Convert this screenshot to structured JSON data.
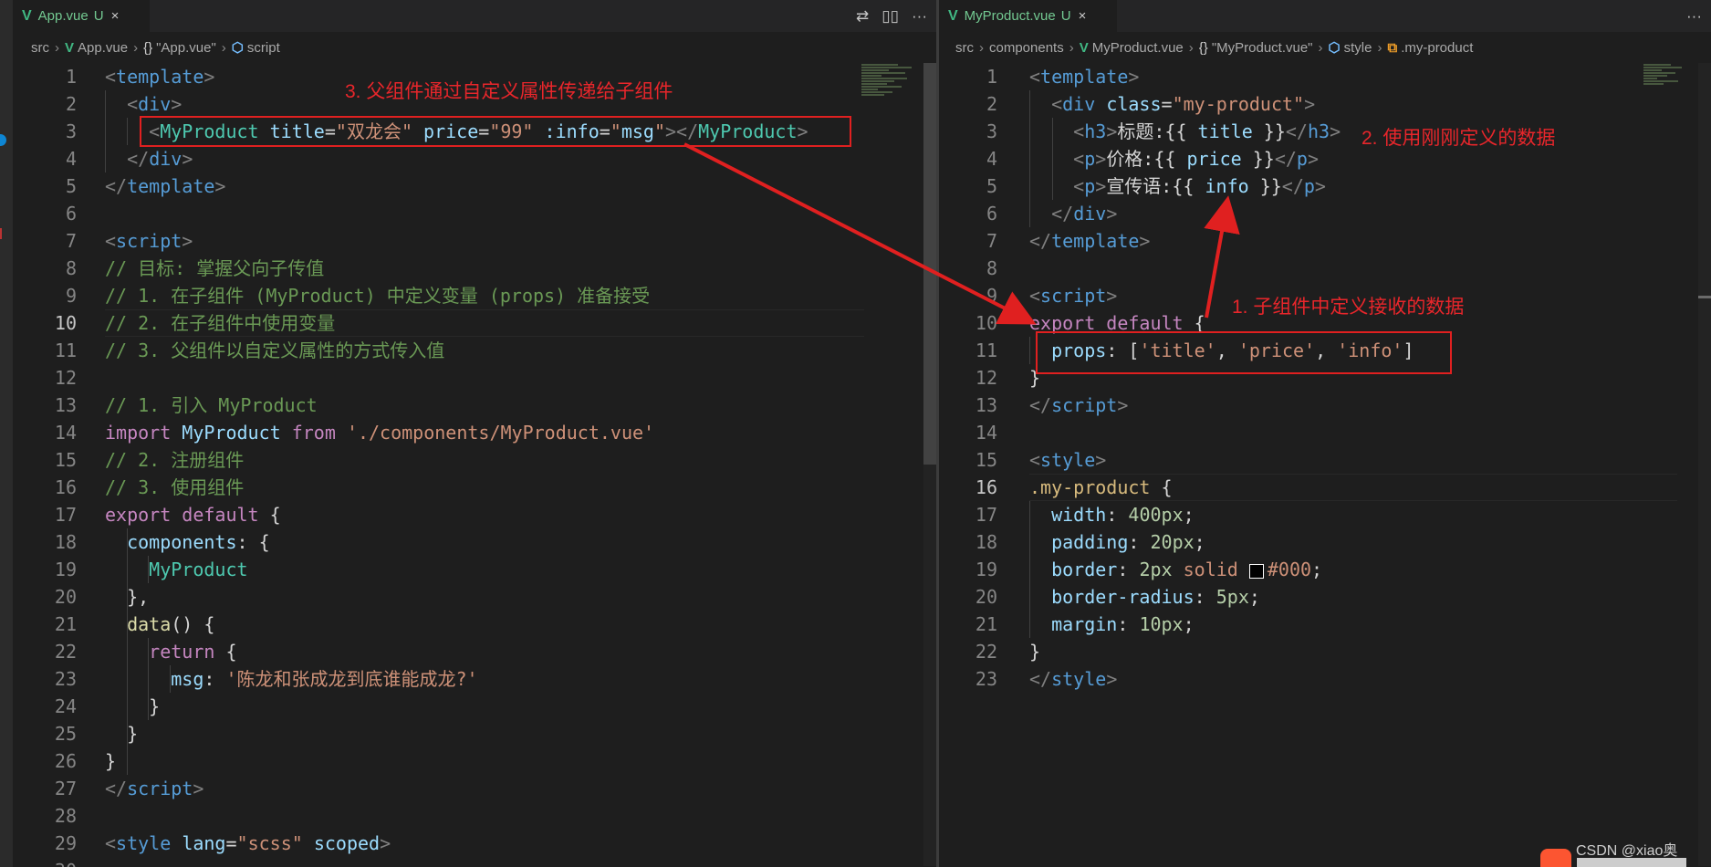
{
  "left_editor": {
    "tab": {
      "filename": "App.vue",
      "status": "U",
      "close": "×"
    },
    "tab_actions": [
      "⇄",
      "▯▯",
      "···"
    ],
    "breadcrumb": [
      "src",
      "App.vue",
      "\"App.vue\"",
      "script"
    ],
    "line_numbers": [
      "1",
      "2",
      "3",
      "4",
      "5",
      "6",
      "7",
      "8",
      "9",
      "10",
      "11",
      "12",
      "13",
      "14",
      "15",
      "16",
      "17",
      "18",
      "19",
      "20",
      "21",
      "22",
      "23",
      "24",
      "25",
      "26",
      "27",
      "28",
      "29",
      "30"
    ],
    "lines": [
      [
        [
          "<",
          "t-punc"
        ],
        [
          "template",
          "t-tag"
        ],
        [
          ">",
          "t-punc"
        ]
      ],
      [
        [
          "  ",
          "t-txt"
        ],
        [
          "<",
          "t-punc"
        ],
        [
          "div",
          "t-tag"
        ],
        [
          ">",
          "t-punc"
        ]
      ],
      [
        [
          "    ",
          "t-txt"
        ],
        [
          "<",
          "t-punc"
        ],
        [
          "MyProduct",
          "t-cmp"
        ],
        [
          " ",
          "t-txt"
        ],
        [
          "title",
          "t-attr"
        ],
        [
          "=",
          "t-txt"
        ],
        [
          "\"双龙会\"",
          "t-str"
        ],
        [
          " ",
          "t-txt"
        ],
        [
          "price",
          "t-attr"
        ],
        [
          "=",
          "t-txt"
        ],
        [
          "\"99\"",
          "t-str"
        ],
        [
          " ",
          "t-txt"
        ],
        [
          ":info",
          "t-attr"
        ],
        [
          "=",
          "t-txt"
        ],
        [
          "\"",
          "t-str"
        ],
        [
          "msg",
          "t-attr"
        ],
        [
          "\"",
          "t-str"
        ],
        [
          "></",
          "t-punc"
        ],
        [
          "MyProduct",
          "t-cmp"
        ],
        [
          ">",
          "t-punc"
        ]
      ],
      [
        [
          "  ",
          "t-txt"
        ],
        [
          "</",
          "t-punc"
        ],
        [
          "div",
          "t-tag"
        ],
        [
          ">",
          "t-punc"
        ]
      ],
      [
        [
          "</",
          "t-punc"
        ],
        [
          "template",
          "t-tag"
        ],
        [
          ">",
          "t-punc"
        ]
      ],
      [],
      [
        [
          "<",
          "t-punc"
        ],
        [
          "script",
          "t-tag"
        ],
        [
          ">",
          "t-punc"
        ]
      ],
      [
        [
          "// 目标: 掌握父向子传值",
          "t-com"
        ]
      ],
      [
        [
          "// 1. 在子组件 (MyProduct) 中定义变量 (props) 准备接受",
          "t-com"
        ]
      ],
      [
        [
          "// 2. 在子组件中使用变量",
          "t-com"
        ]
      ],
      [
        [
          "// 3. 父组件以自定义属性的方式传入值",
          "t-com"
        ]
      ],
      [],
      [
        [
          "// 1. 引入 MyProduct",
          "t-com"
        ]
      ],
      [
        [
          "import",
          "t-kw"
        ],
        [
          " ",
          "t-txt"
        ],
        [
          "MyProduct",
          "t-attr"
        ],
        [
          " ",
          "t-txt"
        ],
        [
          "from",
          "t-kw"
        ],
        [
          " ",
          "t-txt"
        ],
        [
          "'./components/MyProduct.vue'",
          "t-str"
        ]
      ],
      [
        [
          "// 2. 注册组件",
          "t-com"
        ]
      ],
      [
        [
          "// 3. 使用组件",
          "t-com"
        ]
      ],
      [
        [
          "export",
          "t-kw"
        ],
        [
          " ",
          "t-txt"
        ],
        [
          "default",
          "t-kw"
        ],
        [
          " {",
          "t-txt"
        ]
      ],
      [
        [
          "  ",
          "t-txt"
        ],
        [
          "components",
          "t-prop"
        ],
        [
          ": {",
          "t-txt"
        ]
      ],
      [
        [
          "    ",
          "t-txt"
        ],
        [
          "MyProduct",
          "t-cmp"
        ]
      ],
      [
        [
          "  ",
          "t-txt"
        ],
        [
          "},",
          "t-txt"
        ]
      ],
      [
        [
          "  ",
          "t-txt"
        ],
        [
          "data",
          "t-fn"
        ],
        [
          "() {",
          "t-txt"
        ]
      ],
      [
        [
          "    ",
          "t-txt"
        ],
        [
          "return",
          "t-kw"
        ],
        [
          " {",
          "t-txt"
        ]
      ],
      [
        [
          "      ",
          "t-txt"
        ],
        [
          "msg",
          "t-prop"
        ],
        [
          ": ",
          "t-txt"
        ],
        [
          "'陈龙和张成龙到底谁能成龙?'",
          "t-str"
        ]
      ],
      [
        [
          "    ",
          "t-txt"
        ],
        [
          "}",
          "t-txt"
        ]
      ],
      [
        [
          "  ",
          "t-txt"
        ],
        [
          "}",
          "t-txt"
        ]
      ],
      [
        [
          "}",
          "t-txt"
        ]
      ],
      [
        [
          "</",
          "t-punc"
        ],
        [
          "script",
          "t-tag"
        ],
        [
          ">",
          "t-punc"
        ]
      ],
      [],
      [
        [
          "<",
          "t-punc"
        ],
        [
          "style",
          "t-tag"
        ],
        [
          " ",
          "t-txt"
        ],
        [
          "lang",
          "t-attr"
        ],
        [
          "=",
          "t-txt"
        ],
        [
          "\"scss\"",
          "t-str"
        ],
        [
          " ",
          "t-txt"
        ],
        [
          "scoped",
          "t-attr"
        ],
        [
          ">",
          "t-punc"
        ]
      ],
      []
    ],
    "annotation": "3. 父组件通过自定义属性传递给子组件"
  },
  "right_editor": {
    "tab": {
      "filename": "MyProduct.vue",
      "status": "U",
      "close": "×"
    },
    "tab_actions": [
      "···"
    ],
    "breadcrumb": [
      "src",
      "components",
      "MyProduct.vue",
      "\"MyProduct.vue\"",
      "style",
      ".my-product"
    ],
    "line_numbers": [
      "1",
      "2",
      "3",
      "4",
      "5",
      "6",
      "7",
      "8",
      "9",
      "10",
      "11",
      "12",
      "13",
      "14",
      "15",
      "16",
      "17",
      "18",
      "19",
      "20",
      "21",
      "22",
      "23"
    ],
    "lines": [
      [
        [
          "<",
          "t-punc"
        ],
        [
          "template",
          "t-tag"
        ],
        [
          ">",
          "t-punc"
        ]
      ],
      [
        [
          "  ",
          "t-txt"
        ],
        [
          "<",
          "t-punc"
        ],
        [
          "div",
          "t-tag"
        ],
        [
          " ",
          "t-txt"
        ],
        [
          "class",
          "t-attr"
        ],
        [
          "=",
          "t-txt"
        ],
        [
          "\"my-product\"",
          "t-str"
        ],
        [
          ">",
          "t-punc"
        ]
      ],
      [
        [
          "    ",
          "t-txt"
        ],
        [
          "<",
          "t-punc"
        ],
        [
          "h3",
          "t-tag"
        ],
        [
          ">",
          "t-punc"
        ],
        [
          "标题:{{ ",
          "t-txt"
        ],
        [
          "title",
          "t-attr"
        ],
        [
          " }}",
          "t-txt"
        ],
        [
          "</",
          "t-punc"
        ],
        [
          "h3",
          "t-tag"
        ],
        [
          ">",
          "t-punc"
        ]
      ],
      [
        [
          "    ",
          "t-txt"
        ],
        [
          "<",
          "t-punc"
        ],
        [
          "p",
          "t-tag"
        ],
        [
          ">",
          "t-punc"
        ],
        [
          "价格:{{ ",
          "t-txt"
        ],
        [
          "price",
          "t-attr"
        ],
        [
          " }}",
          "t-txt"
        ],
        [
          "</",
          "t-punc"
        ],
        [
          "p",
          "t-tag"
        ],
        [
          ">",
          "t-punc"
        ]
      ],
      [
        [
          "    ",
          "t-txt"
        ],
        [
          "<",
          "t-punc"
        ],
        [
          "p",
          "t-tag"
        ],
        [
          ">",
          "t-punc"
        ],
        [
          "宣传语:{{ ",
          "t-txt"
        ],
        [
          "info",
          "t-attr"
        ],
        [
          " }}",
          "t-txt"
        ],
        [
          "</",
          "t-punc"
        ],
        [
          "p",
          "t-tag"
        ],
        [
          ">",
          "t-punc"
        ]
      ],
      [
        [
          "  ",
          "t-txt"
        ],
        [
          "</",
          "t-punc"
        ],
        [
          "div",
          "t-tag"
        ],
        [
          ">",
          "t-punc"
        ]
      ],
      [
        [
          "</",
          "t-punc"
        ],
        [
          "template",
          "t-tag"
        ],
        [
          ">",
          "t-punc"
        ]
      ],
      [],
      [
        [
          "<",
          "t-punc"
        ],
        [
          "script",
          "t-tag"
        ],
        [
          ">",
          "t-punc"
        ]
      ],
      [
        [
          "export",
          "t-kw"
        ],
        [
          " ",
          "t-txt"
        ],
        [
          "default",
          "t-kw"
        ],
        [
          " {",
          "t-txt"
        ]
      ],
      [
        [
          "  ",
          "t-txt"
        ],
        [
          "props",
          "t-prop"
        ],
        [
          ": [",
          "t-txt"
        ],
        [
          "'title'",
          "t-str"
        ],
        [
          ", ",
          "t-txt"
        ],
        [
          "'price'",
          "t-str"
        ],
        [
          ", ",
          "t-txt"
        ],
        [
          "'info'",
          "t-str"
        ],
        [
          "]",
          "t-txt"
        ]
      ],
      [
        [
          "}",
          "t-txt"
        ]
      ],
      [
        [
          "</",
          "t-punc"
        ],
        [
          "script",
          "t-tag"
        ],
        [
          ">",
          "t-punc"
        ]
      ],
      [],
      [
        [
          "<",
          "t-punc"
        ],
        [
          "style",
          "t-tag"
        ],
        [
          ">",
          "t-punc"
        ]
      ],
      [
        [
          ".my-product",
          "t-sel"
        ],
        [
          " {",
          "t-txt"
        ]
      ],
      [
        [
          "  ",
          "t-txt"
        ],
        [
          "width",
          "t-prop"
        ],
        [
          ": ",
          "t-txt"
        ],
        [
          "400px",
          "t-num"
        ],
        [
          ";",
          "t-txt"
        ]
      ],
      [
        [
          "  ",
          "t-txt"
        ],
        [
          "padding",
          "t-prop"
        ],
        [
          ": ",
          "t-txt"
        ],
        [
          "20px",
          "t-num"
        ],
        [
          ";",
          "t-txt"
        ]
      ],
      [
        [
          "  ",
          "t-txt"
        ],
        [
          "border",
          "t-prop"
        ],
        [
          ": ",
          "t-txt"
        ],
        [
          "2px",
          "t-num"
        ],
        [
          " ",
          "t-txt"
        ],
        [
          "solid",
          "t-val"
        ],
        [
          " ",
          "t-txt"
        ],
        [
          "SWATCH",
          "t-txt"
        ],
        [
          "#000",
          "t-val"
        ],
        [
          ";",
          "t-txt"
        ]
      ],
      [
        [
          "  ",
          "t-txt"
        ],
        [
          "border-radius",
          "t-prop"
        ],
        [
          ": ",
          "t-txt"
        ],
        [
          "5px",
          "t-num"
        ],
        [
          ";",
          "t-txt"
        ]
      ],
      [
        [
          "  ",
          "t-txt"
        ],
        [
          "margin",
          "t-prop"
        ],
        [
          ": ",
          "t-txt"
        ],
        [
          "10px",
          "t-num"
        ],
        [
          ";",
          "t-txt"
        ]
      ],
      [
        [
          "}",
          "t-txt"
        ]
      ],
      [
        [
          "</",
          "t-punc"
        ],
        [
          "style",
          "t-tag"
        ],
        [
          ">",
          "t-punc"
        ]
      ]
    ],
    "annotation_1": "1. 子组件中定义接收的数据",
    "annotation_2": "2. 使用刚刚定义的数据"
  },
  "watermark": "CSDN @xiao奥",
  "colors": {
    "annotation": "#e8262b",
    "vue_icon": "#41b883",
    "tab_modified": "#73c991"
  }
}
